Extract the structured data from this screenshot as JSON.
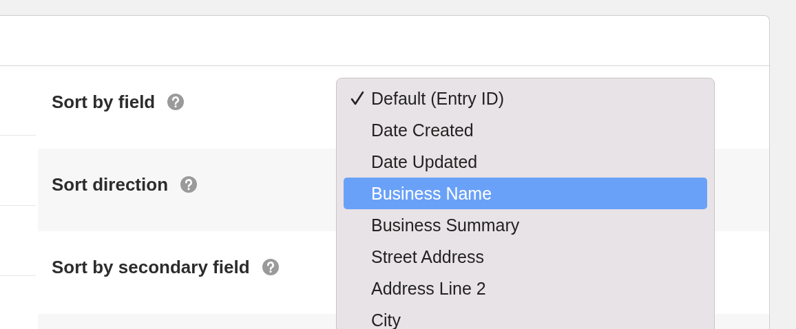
{
  "settings": [
    {
      "kind": "setting",
      "label": "Sort by field"
    },
    {
      "kind": "setting",
      "label": "Sort direction"
    },
    {
      "kind": "setting",
      "label": "Sort by secondary field"
    },
    {
      "kind": "blank"
    }
  ],
  "dropdown": {
    "options": [
      {
        "label": "Default (Entry ID)",
        "checked": true,
        "selected": false
      },
      {
        "label": "Date Created",
        "checked": false,
        "selected": false
      },
      {
        "label": "Date Updated",
        "checked": false,
        "selected": false
      },
      {
        "label": "Business Name",
        "checked": false,
        "selected": true
      },
      {
        "label": "Business Summary",
        "checked": false,
        "selected": false
      },
      {
        "label": "Street Address",
        "checked": false,
        "selected": false
      },
      {
        "label": "Address Line 2",
        "checked": false,
        "selected": false
      },
      {
        "label": "City",
        "checked": false,
        "selected": false
      }
    ]
  }
}
